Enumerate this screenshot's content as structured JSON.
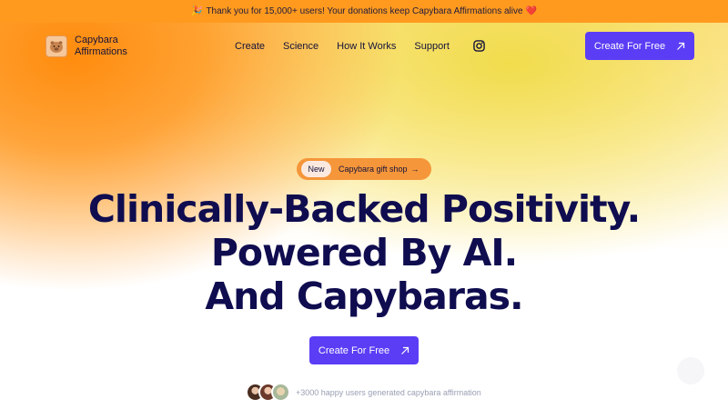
{
  "banner": {
    "emoji": "🎉",
    "text": "Thank you for 15,000+ users! Your donations keep Capybara Affirmations alive",
    "heart": "❤️"
  },
  "brand": {
    "line1": "Capybara",
    "line2": "Affirmations",
    "icon": "capybara-logo-icon"
  },
  "nav": {
    "items": [
      {
        "label": "Create"
      },
      {
        "label": "Science"
      },
      {
        "label": "How It Works"
      },
      {
        "label": "Support"
      }
    ],
    "instagram_icon": "instagram-icon",
    "cta_label": "Create For Free"
  },
  "hero": {
    "badge_label": "New",
    "badge_text": "Capybara gift shop",
    "badge_arrow": "→",
    "headline_line1": "Clinically-Backed Positivity.",
    "headline_line2": "Powered By AI.",
    "headline_line3": "And Capybaras.",
    "cta_label": "Create For Free",
    "social_proof": "+3000 happy users generated capybara affirmation"
  },
  "colors": {
    "accent": "#5b3df5",
    "banner": "#ff9a1f",
    "headline": "#0f0c4f"
  }
}
